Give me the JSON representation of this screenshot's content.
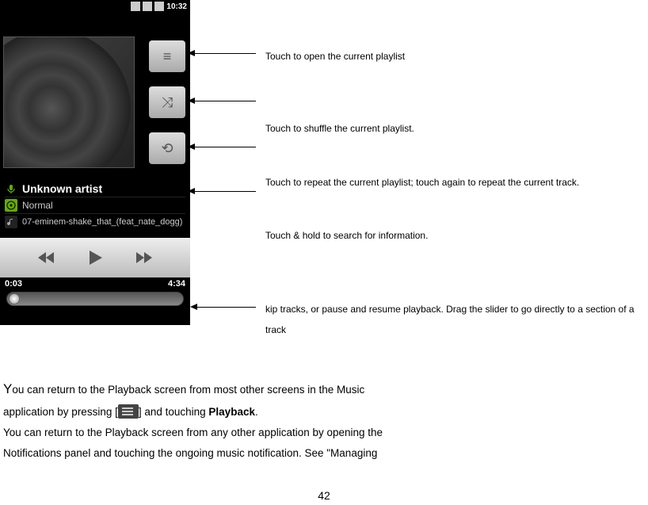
{
  "phone": {
    "statusbar": {
      "time": "10:32"
    },
    "buttons": {
      "playlist_icon": "≡",
      "shuffle_icon": "⤨",
      "repeat_icon": "⟲"
    },
    "info": {
      "artist": "Unknown artist",
      "album": "Normal",
      "track": "07-eminem-shake_that_(feat_nate_dogg)"
    },
    "time": {
      "elapsed": "0:03",
      "total": "4:34"
    }
  },
  "annotations": {
    "a1": "Touch to open the current playlist",
    "a2": "Touch to shuffle the current playlist.",
    "a3": "Touch to repeat the current playlist; touch again to repeat the current track.",
    "a4": "Touch & hold to search for information.",
    "a5": "kip tracks, or pause and resume playback. Drag the slider to go directly to a section of a track"
  },
  "body": {
    "p1a": "Y",
    "p1b": "ou can return to the Playback screen from most other screens in the Music",
    "p2a": "application by pressing [",
    "p2b": "] and touching ",
    "p2c": "Playback",
    "p2d": ".",
    "p3": "You can return to the Playback screen from any other application by opening the",
    "p4": "Notifications panel and touching the ongoing music notification. See \"Managing"
  },
  "page_number": "42"
}
